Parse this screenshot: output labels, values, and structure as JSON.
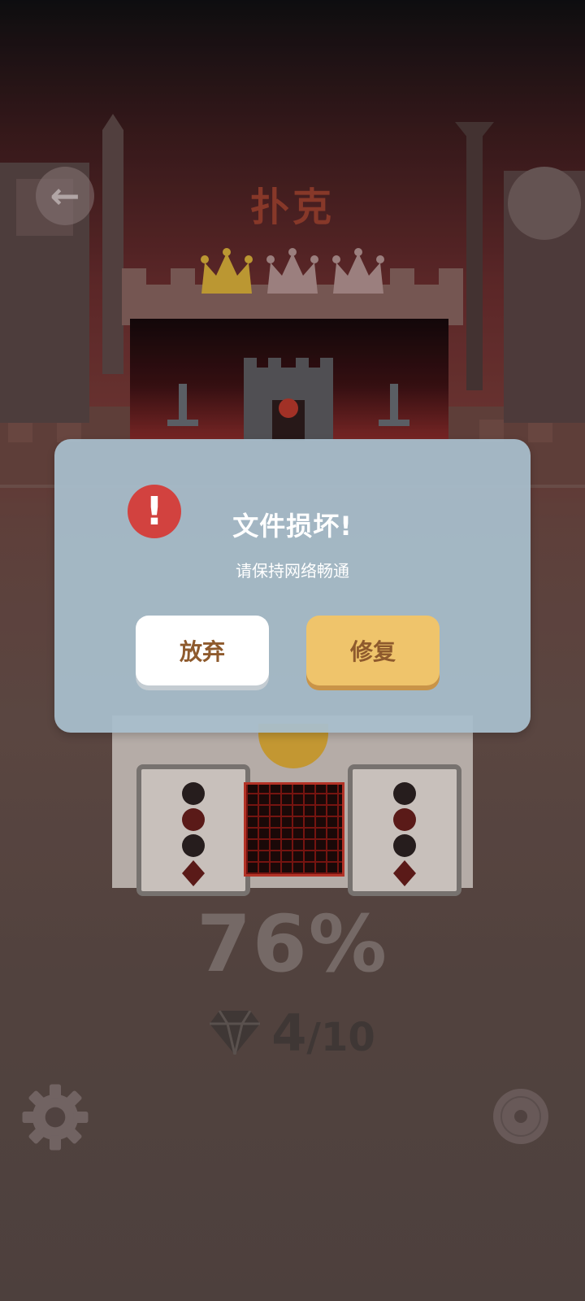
{
  "header": {
    "back_icon": "back-arrow-icon",
    "level_title": "扑克"
  },
  "crowns": {
    "earned": 1,
    "total": 3,
    "earned_color": "#e0b53a",
    "unearned_color": "#b99896"
  },
  "progress": {
    "percent_text": "76%",
    "value": 76
  },
  "gems": {
    "icon": "diamond-icon",
    "collected": "4",
    "total_text": "/10"
  },
  "bottom": {
    "settings_icon": "gear-icon",
    "music_icon": "vinyl-disc-icon"
  },
  "dialog": {
    "icon": "exclamation-icon",
    "title": "文件损坏!",
    "message": "请保持网络畅通",
    "abandon_label": "放弃",
    "repair_label": "修复",
    "accent_color": "#efc46b",
    "alert_color": "#d2423f"
  }
}
